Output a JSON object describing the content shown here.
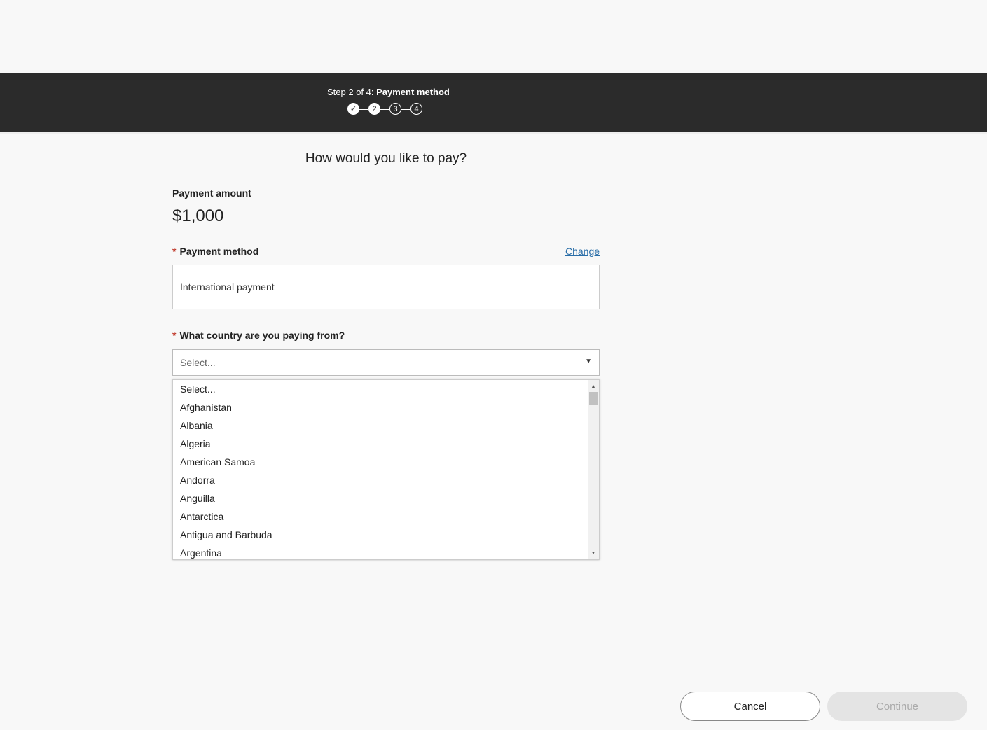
{
  "header": {
    "step_prefix": "Step 2 of 4: ",
    "step_name": "Payment method",
    "steps": [
      {
        "label": "✓",
        "state": "done"
      },
      {
        "label": "2",
        "state": "current"
      },
      {
        "label": "3",
        "state": "upcoming"
      },
      {
        "label": "4",
        "state": "upcoming"
      }
    ]
  },
  "main": {
    "title": "How would you like to pay?",
    "payment_amount_label": "Payment amount",
    "payment_amount_value": "$1,000",
    "required_marker": "*",
    "payment_method_label": "Payment method",
    "change_link": "Change",
    "payment_method_value": "International payment",
    "country_label": "What country are you paying from?",
    "country_select_value": "Select...",
    "country_options": [
      "Select...",
      "Afghanistan",
      "Albania",
      "Algeria",
      "American Samoa",
      "Andorra",
      "Anguilla",
      "Antarctica",
      "Antigua and Barbuda",
      "Argentina"
    ]
  },
  "footer": {
    "cancel_label": "Cancel",
    "continue_label": "Continue"
  },
  "icons": {
    "select_caret": "caret-down-icon",
    "scroll_up": "scroll-up-arrow-icon",
    "scroll_down": "scroll-down-arrow-icon",
    "check": "check-icon"
  },
  "colors": {
    "header_bg": "#2b2b2b",
    "required": "#c0392b",
    "link": "#2a6ea8"
  }
}
